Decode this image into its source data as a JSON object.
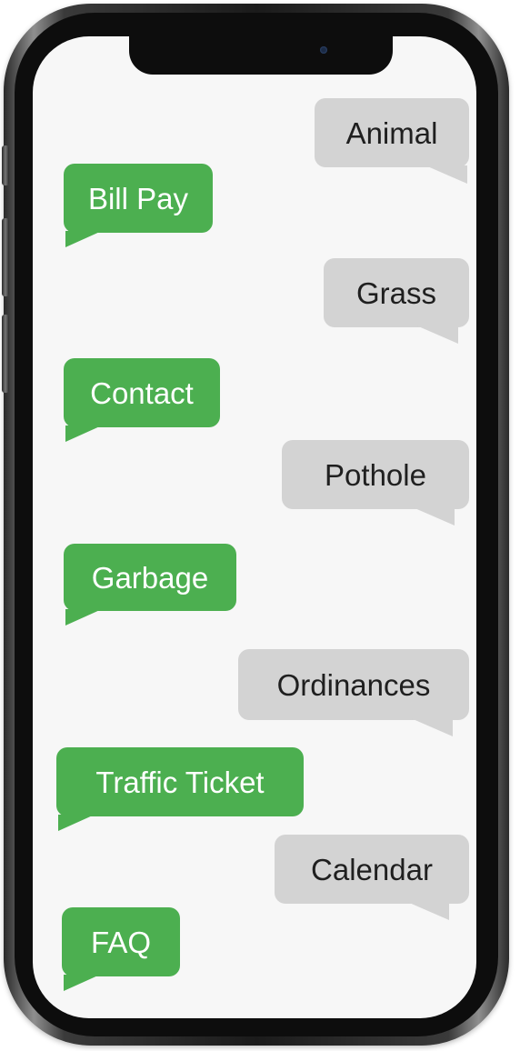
{
  "colors": {
    "green_bubble": "#4caf50",
    "gray_bubble": "#d3d3d3",
    "screen_bg": "#f7f7f7"
  },
  "messages": [
    {
      "label": "Animal",
      "side": "gray"
    },
    {
      "label": "Bill Pay",
      "side": "green"
    },
    {
      "label": "Grass",
      "side": "gray"
    },
    {
      "label": "Contact",
      "side": "green"
    },
    {
      "label": "Pothole",
      "side": "gray"
    },
    {
      "label": "Garbage",
      "side": "green"
    },
    {
      "label": "Ordinances",
      "side": "gray"
    },
    {
      "label": "Traffic Ticket",
      "side": "green"
    },
    {
      "label": "Calendar",
      "side": "gray"
    },
    {
      "label": "FAQ",
      "side": "green"
    }
  ]
}
